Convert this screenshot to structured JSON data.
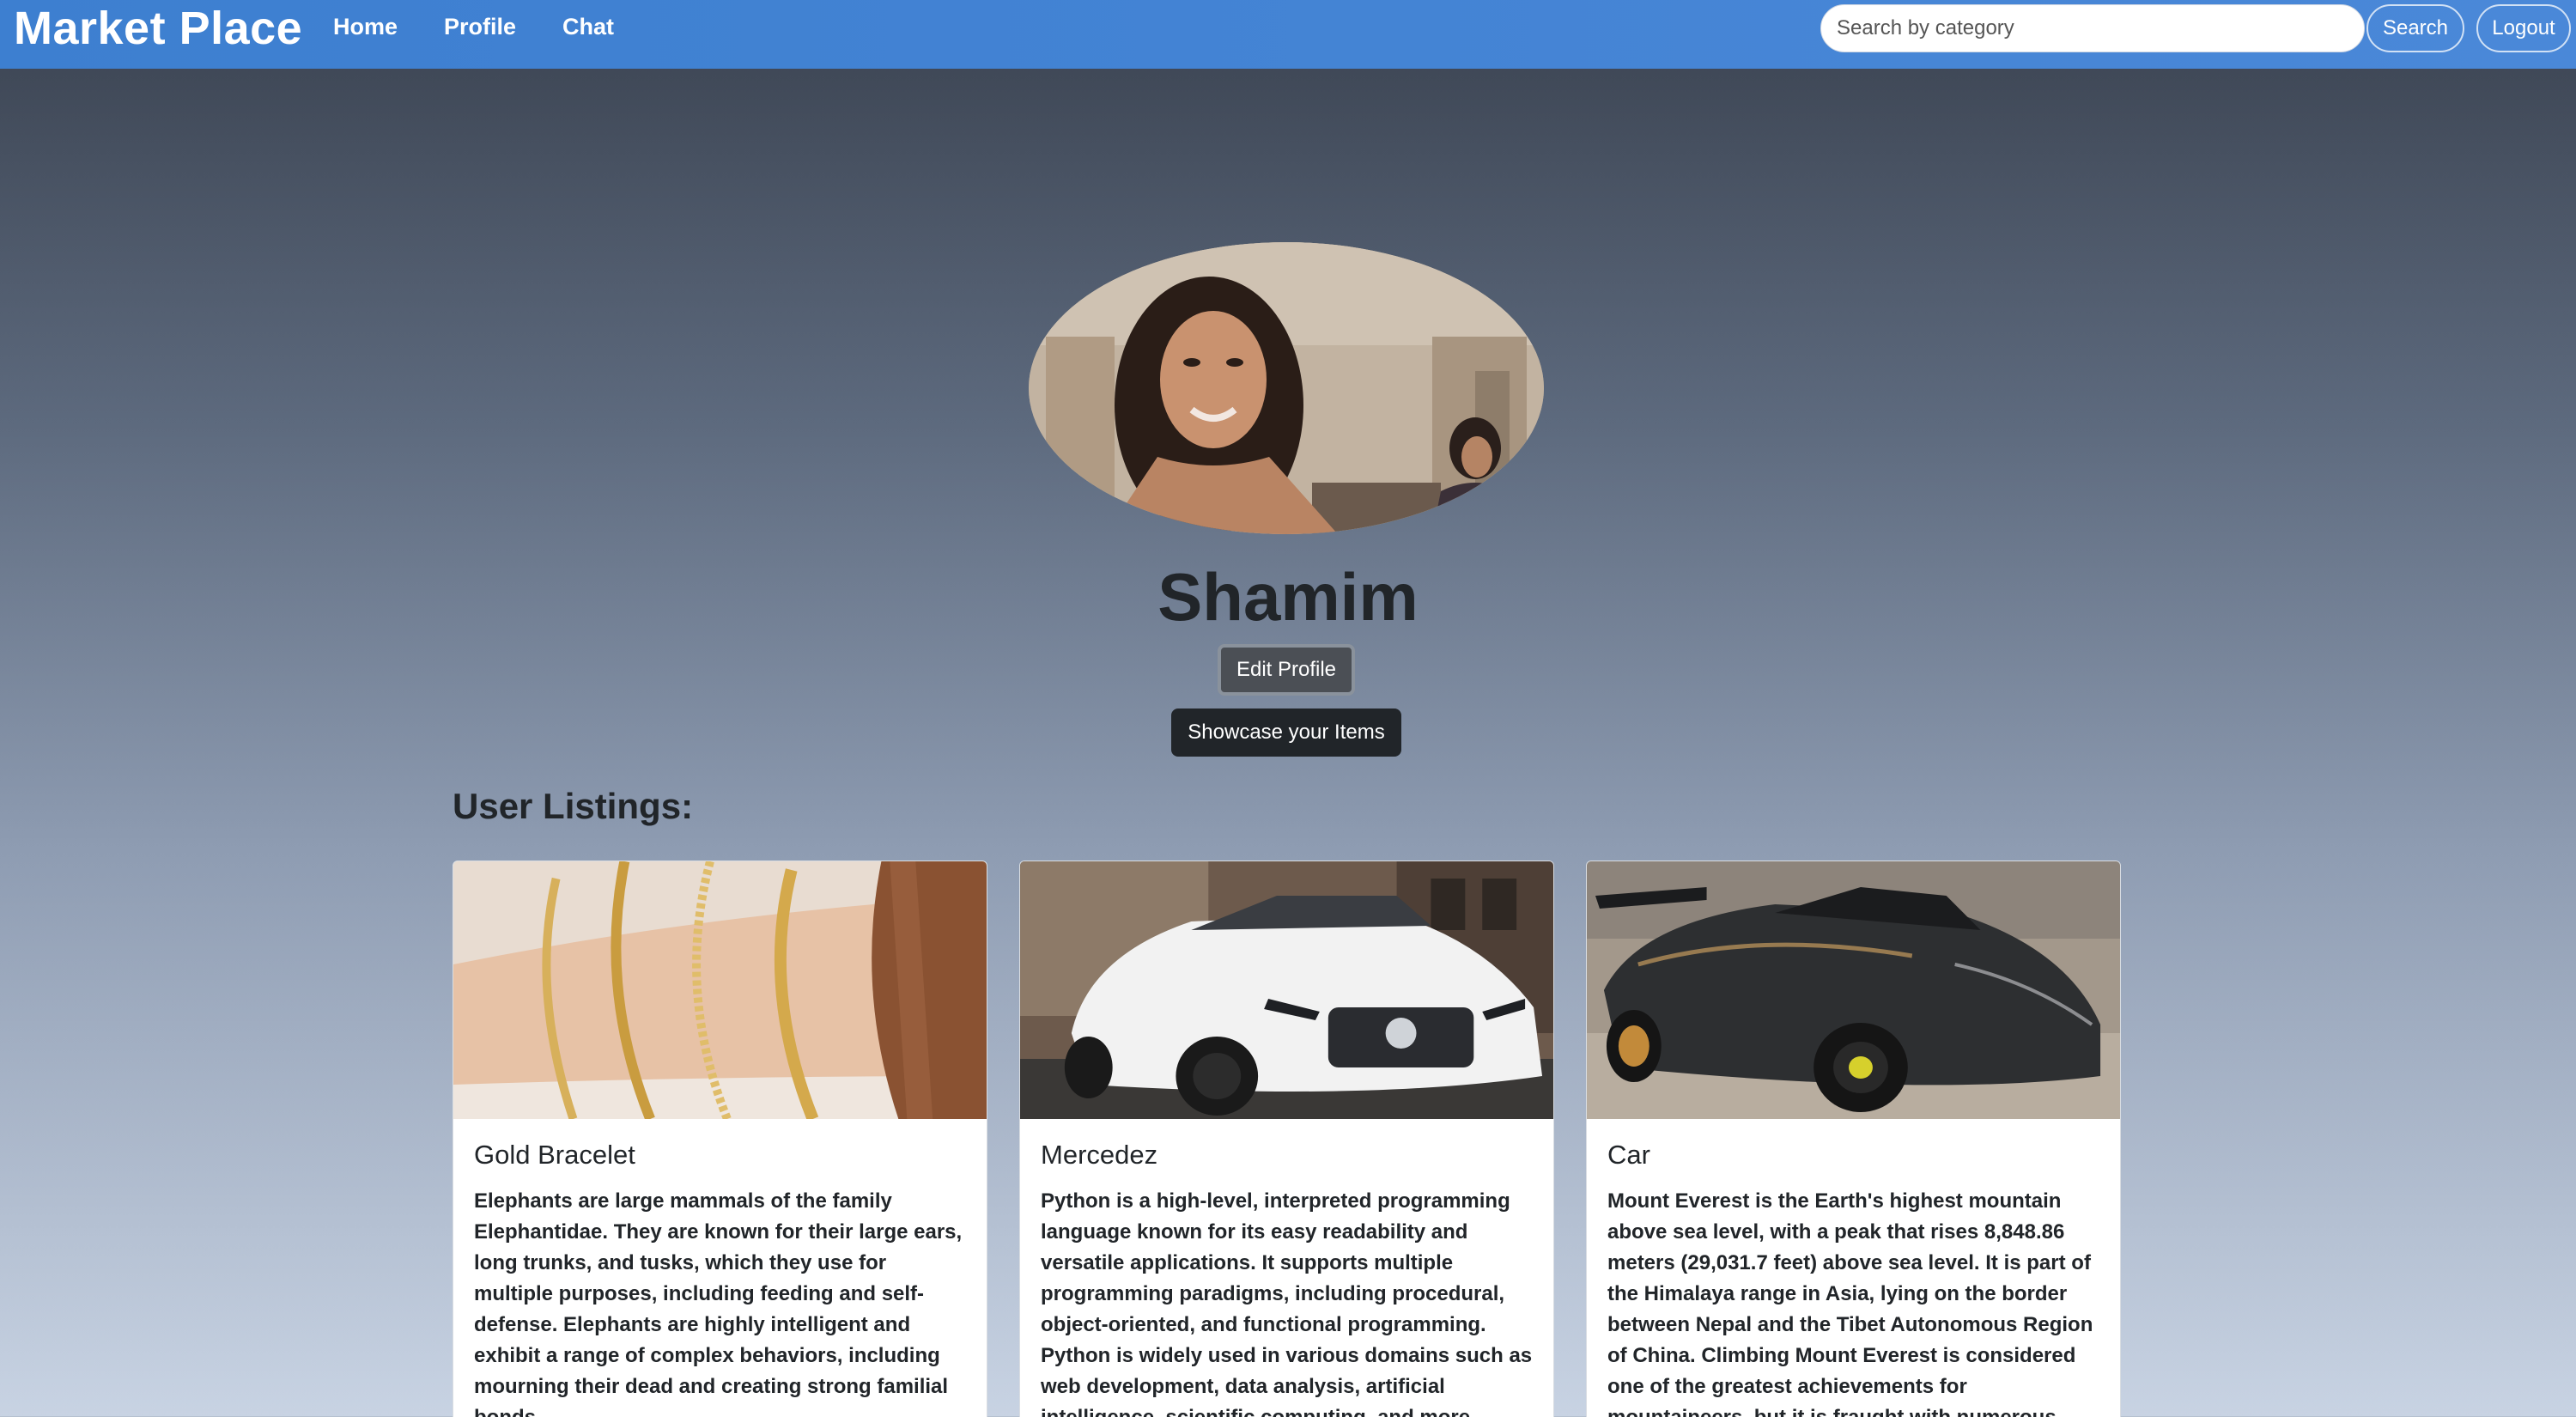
{
  "navbar": {
    "brand": "Market Place",
    "links": {
      "home": "Home",
      "profile": "Profile",
      "chat": "Chat"
    },
    "search": {
      "placeholder": "Search by category",
      "value": ""
    },
    "search_button": "Search",
    "logout_button": "Logout"
  },
  "profile": {
    "username": "Shamim",
    "edit_button": "Edit Profile",
    "showcase_button": "Showcase your Items"
  },
  "listings": {
    "heading": "User Listings:",
    "items": [
      {
        "title": "Gold Bracelet",
        "image": "gold-bracelets-on-wrist",
        "description": "Elephants are large mammals of the family Elephantidae. They are known for their large ears, long trunks, and tusks, which they use for multiple purposes, including feeding and self-defense. Elephants are highly intelligent and exhibit a range of complex behaviors, including mourning their dead and creating strong familial bonds."
      },
      {
        "title": "Mercedez",
        "image": "white-mercedes-sedan",
        "description": "Python is a high-level, interpreted programming language known for its easy readability and versatile applications. It supports multiple programming paradigms, including procedural, object-oriented, and functional programming. Python is widely used in various domains such as web development, data analysis, artificial intelligence, scientific computing, and more."
      },
      {
        "title": "Car",
        "image": "dark-sports-car",
        "description": "Mount Everest is the Earth's highest mountain above sea level, with a peak that rises 8,848.86 meters (29,031.7 feet) above sea level. It is part of the Himalaya range in Asia, lying on the border between Nepal and the Tibet Autonomous Region of China. Climbing Mount Everest is considered one of the greatest achievements for mountaineers, but it is fraught with numerous"
      }
    ]
  },
  "colors": {
    "navbar": "#3d7fd0",
    "button_dark": "#212529",
    "button_edit": "#4b4f55"
  }
}
